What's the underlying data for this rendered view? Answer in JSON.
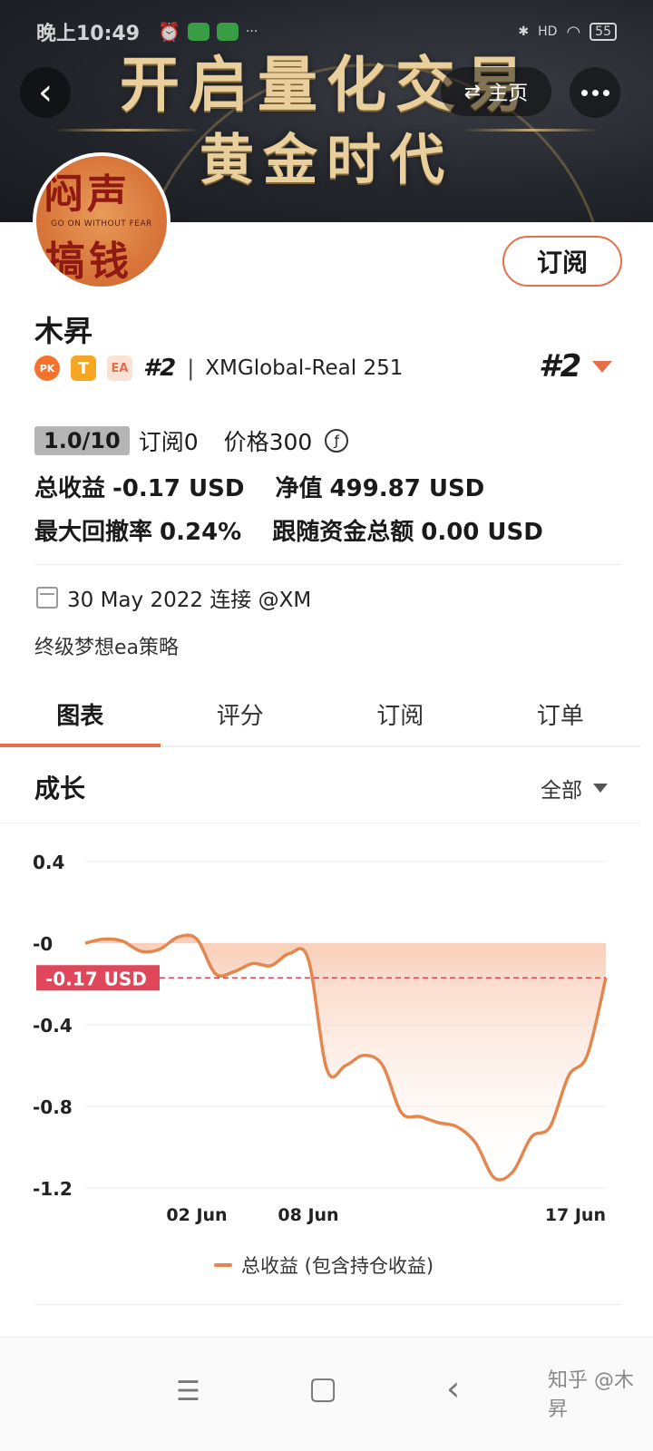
{
  "status_bar": {
    "time": "晚上10:49",
    "battery": "55",
    "hd": "HD"
  },
  "banner": {
    "line1": "开启量化交易",
    "line2": "黄金时代"
  },
  "nav": {
    "home_label": "主页"
  },
  "avatar": {
    "top": "闷声",
    "bottom": "搞钱",
    "sub": "GO ON WITHOUT FEAR"
  },
  "profile": {
    "subscribe_label": "订阅",
    "name": "木昇",
    "badges": {
      "pk": "PK",
      "t": "T",
      "ea": "EA"
    },
    "rank": "#2",
    "server": "XMGlobal-Real 251",
    "rank_right": "#2"
  },
  "stats": {
    "version": "1.0/10",
    "subscribers": "订阅0",
    "price": "价格300",
    "coin": "ƒ",
    "total_profit_label": "总收益",
    "total_profit": "-0.17 USD",
    "equity_label": "净值",
    "equity": "499.87 USD",
    "drawdown_label": "最大回撤率",
    "drawdown": "0.24%",
    "follow_label": "跟随资金总额",
    "follow": "0.00 USD"
  },
  "meta": {
    "date": "30 May 2022 连接 @XM",
    "description": "终级梦想ea策略"
  },
  "tabs": [
    {
      "label": "图表",
      "active": true
    },
    {
      "label": "评分",
      "active": false
    },
    {
      "label": "订阅",
      "active": false
    },
    {
      "label": "订单",
      "active": false
    }
  ],
  "growth": {
    "title": "成长",
    "range": "全部"
  },
  "chart_data": {
    "type": "area",
    "y_ticks": [
      "0.4",
      "-0",
      "-0.4",
      "-0.8",
      "-1.2"
    ],
    "ylim": [
      -1.2,
      0.4
    ],
    "x_ticks": [
      "02 Jun",
      "08 Jun",
      "17 Jun"
    ],
    "current_label": "-0.17 USD",
    "current_value": -0.17,
    "series": [
      {
        "name": "总收益 (包含持仓收益)",
        "values": [
          0.0,
          0.02,
          0.01,
          -0.04,
          -0.03,
          0.03,
          0.02,
          -0.15,
          -0.14,
          -0.1,
          -0.11,
          -0.05,
          -0.08,
          -0.62,
          -0.6,
          -0.55,
          -0.6,
          -0.83,
          -0.85,
          -0.88,
          -0.9,
          -0.98,
          -1.15,
          -1.12,
          -0.95,
          -0.9,
          -0.65,
          -0.55,
          -0.17
        ]
      }
    ],
    "colors": {
      "line": "#e4874f",
      "fill_top": "#f8c7ae",
      "marker": "#e0475a"
    }
  },
  "legend": {
    "label": "总收益 (包含持仓收益)"
  },
  "watermark": "知乎 @木昇"
}
